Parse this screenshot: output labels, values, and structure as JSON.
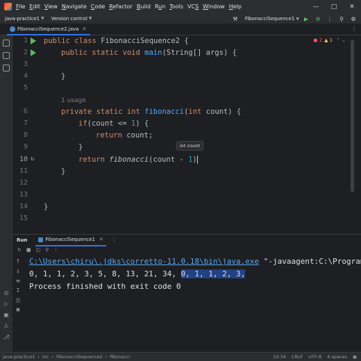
{
  "menu": [
    "File",
    "Edit",
    "View",
    "Navigate",
    "Code",
    "Refactor",
    "Build",
    "Run",
    "Tools",
    "VCS",
    "Window",
    "Help"
  ],
  "menu_mnemonics": [
    "F",
    "E",
    "V",
    "N",
    "C",
    "R",
    "B",
    "u",
    "T",
    "S",
    "W",
    "H"
  ],
  "toolbar": {
    "project": "java-practice1",
    "vcs": "Version control",
    "run_config": "FibonacciSequence1"
  },
  "editor_tab": {
    "label": "FibonacciSequence2.java"
  },
  "inspections": {
    "errors": "2",
    "warnings": "1"
  },
  "code": {
    "line_numbers": [
      "1",
      "2",
      "3",
      "4",
      "5",
      "",
      "6",
      "7",
      "8",
      "9",
      "10",
      "11",
      "12",
      "13",
      "14",
      "15"
    ],
    "l1_kw1": "public",
    "l1_kw2": "class",
    "l1_name": "FibonacciSequence2",
    "l1_brace": "{",
    "l2_kw1": "public",
    "l2_kw2": "static",
    "l2_kw3": "void",
    "l2_fn": "main",
    "l2_rest": "(String[] args) {",
    "l4": "}",
    "usage_hint": "1 usage",
    "l6_kw1": "private",
    "l6_kw2": "static",
    "l6_kw3": "int",
    "l6_fn": "fibonacci",
    "l6_open": "(",
    "l6_kw4": "int",
    "l6_rest": " count) {",
    "l7_kw": "if",
    "l7_a": "(count <= ",
    "l7_num": "1",
    "l7_b": ") {",
    "l8_kw": "return",
    "l8_rest": " count;",
    "l9": "}",
    "l10_kw": "return",
    "l10_fn": "fibonacci",
    "l10_a": "(count - ",
    "l10_num": "1",
    "l10_b": ")",
    "l11": "}",
    "l14": "}"
  },
  "param_tooltip": "int count",
  "run_panel": {
    "title": "Run",
    "tab": "FibonacciSequence1"
  },
  "console": {
    "cmd_path": "C:\\Users\\chiru\\.jdks\\corretto-11.0.18\\bin\\java.exe",
    "cmd_args": " \"-javaagent:C:\\Program",
    "output_plain": "0, 1, 1, 2, 3, 5, 8, 13, 21, 34, ",
    "output_selected": "0, 1, 1, 2, 3,",
    "exit": "Process finished with exit code 0"
  },
  "statusbar": {
    "crumbs": [
      "java-practice1",
      "src",
      "FibonacciSequence2",
      "fibonacci"
    ],
    "position": "10:34",
    "line_sep": "CRLF",
    "encoding": "UTF-8",
    "indent": "4 spaces"
  },
  "colors": {
    "keyword": "#cf8e6d",
    "function": "#56a8f5",
    "number": "#2aacb8",
    "run_green": "#5fb865",
    "accent": "#3574f0"
  }
}
